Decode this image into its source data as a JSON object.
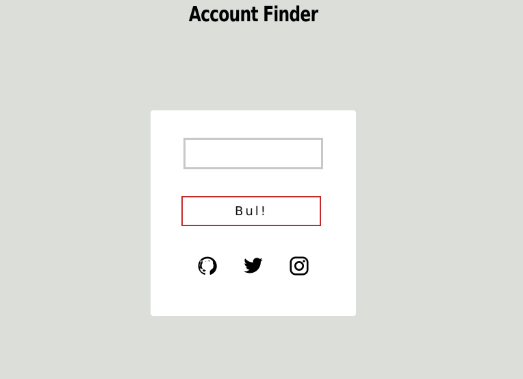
{
  "header": {
    "title": "Account Finder"
  },
  "form": {
    "search_value": "",
    "search_placeholder": "",
    "button_label": "Bul!"
  },
  "social": [
    {
      "icon": "github-icon"
    },
    {
      "icon": "twitter-icon"
    },
    {
      "icon": "instagram-icon"
    }
  ],
  "colors": {
    "background": "#dcdeda",
    "card": "#ffffff",
    "button_border": "#c62828",
    "input_border": "#c8c8c8"
  }
}
